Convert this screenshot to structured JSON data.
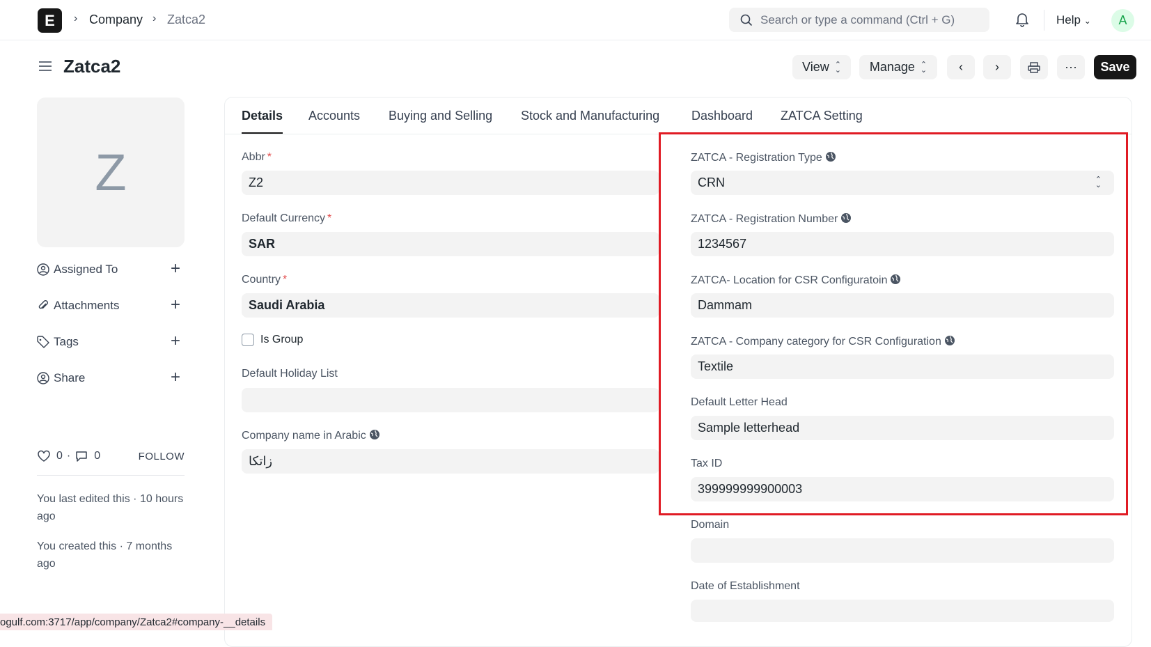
{
  "topbar": {
    "logo_letter": "E",
    "breadcrumbs": [
      "Company",
      "Zatca2"
    ],
    "search_placeholder": "Search or type a command (Ctrl + G)",
    "help_label": "Help",
    "avatar_letter": "A"
  },
  "page": {
    "title": "Zatca2",
    "buttons": {
      "view": "View",
      "manage": "Manage",
      "save": "Save",
      "more": "···"
    }
  },
  "sidebar": {
    "avatar_letter": "Z",
    "items": [
      {
        "label": "Assigned To",
        "icon": "assign-user-icon"
      },
      {
        "label": "Attachments",
        "icon": "paperclip-icon"
      },
      {
        "label": "Tags",
        "icon": "tag-icon"
      },
      {
        "label": "Share",
        "icon": "share-user-icon"
      }
    ],
    "likes": "0",
    "comments": "0",
    "dot": "·",
    "follow": "FOLLOW",
    "last_edited": "You last edited this · 10 hours ago",
    "created": "You created this · 7 months ago"
  },
  "tabs": [
    "Details",
    "Accounts",
    "Buying and Selling",
    "Stock and Manufacturing",
    "Dashboard",
    "ZATCA Setting"
  ],
  "left_fields": {
    "abbr": {
      "label": "Abbr",
      "value": "Z2"
    },
    "currency": {
      "label": "Default Currency",
      "value": "SAR"
    },
    "country": {
      "label": "Country",
      "value": "Saudi Arabia"
    },
    "is_group": {
      "label": "Is Group"
    },
    "holiday": {
      "label": "Default Holiday List",
      "value": ""
    },
    "arabic_name": {
      "label": "Company name in Arabic",
      "value": "زاتكا"
    }
  },
  "right_fields": {
    "reg_type": {
      "label": "ZATCA - Registration Type",
      "value": "CRN"
    },
    "reg_number": {
      "label": "ZATCA - Registration Number",
      "value": "1234567"
    },
    "csr_location": {
      "label": "ZATCA- Location for CSR Configuratoin",
      "value": "Dammam"
    },
    "csr_category": {
      "label": "ZATCA - Company category for CSR Configuration",
      "value": "Textile"
    },
    "letter_head": {
      "label": "Default Letter Head",
      "value": "Sample letterhead"
    },
    "tax_id": {
      "label": "Tax ID",
      "value": "399999999900003"
    },
    "domain": {
      "label": "Domain",
      "value": ""
    },
    "establishment": {
      "label": "Date of Establishment",
      "value": ""
    }
  },
  "status_url": "ogulf.com:3717/app/company/Zatca2#company-__details",
  "colors": {
    "highlight": "#e01b24",
    "primary": "#171717",
    "required": "#e24c4c"
  }
}
